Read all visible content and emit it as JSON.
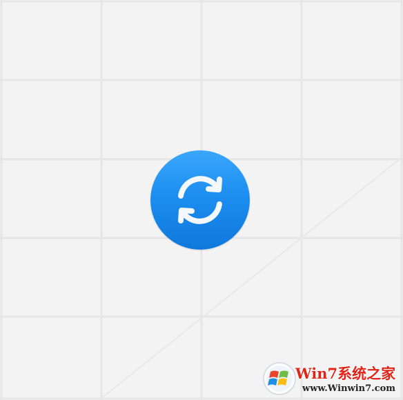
{
  "background": {
    "color": "#f3f3f3",
    "grid_line_color": "#e6e6e6"
  },
  "sync_button": {
    "icon": "sync-icon",
    "fill_top": "#3aa7fb",
    "fill_bottom": "#0f78db",
    "arrow_color": "#f4f8fd"
  },
  "watermark": {
    "logo": "windows-flag-logo",
    "title": "Win7系统之家",
    "url": "www.Winwin7.com",
    "title_color": "#e02418"
  }
}
